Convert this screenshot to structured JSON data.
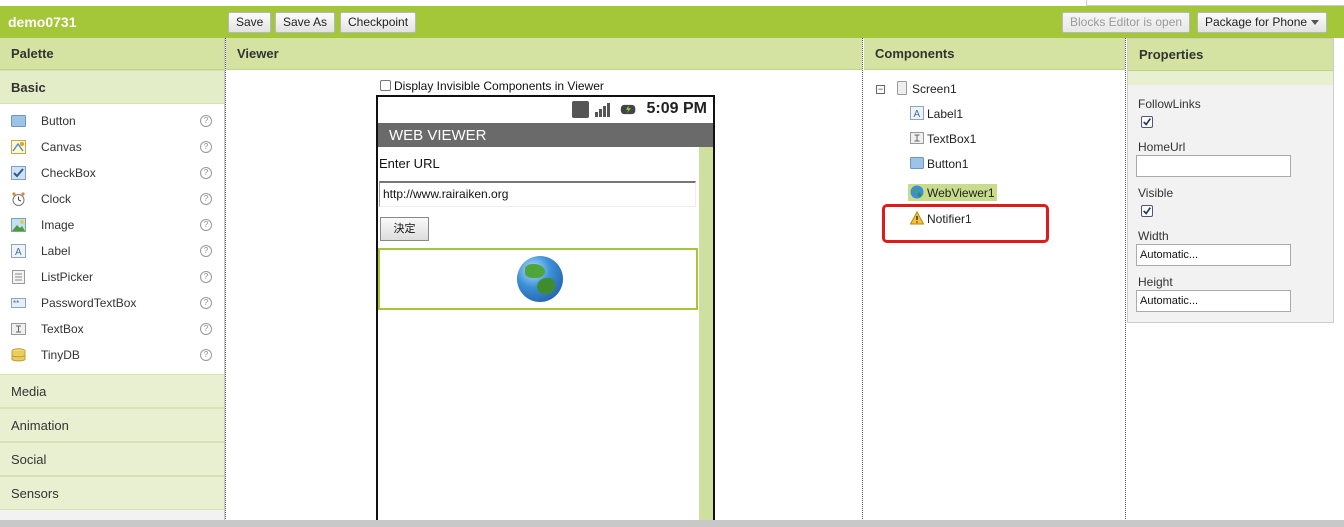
{
  "project": {
    "name": "demo0731"
  },
  "toolbar": {
    "save": "Save",
    "save_as": "Save As",
    "checkpoint": "Checkpoint",
    "blocks_editor": "Blocks Editor is open",
    "package": "Package for Phone"
  },
  "palette": {
    "title": "Palette",
    "basic": "Basic",
    "items": [
      {
        "label": "Button",
        "icon": "button-icon"
      },
      {
        "label": "Canvas",
        "icon": "canvas-icon"
      },
      {
        "label": "CheckBox",
        "icon": "checkbox-icon"
      },
      {
        "label": "Clock",
        "icon": "clock-icon"
      },
      {
        "label": "Image",
        "icon": "image-icon"
      },
      {
        "label": "Label",
        "icon": "label-icon"
      },
      {
        "label": "ListPicker",
        "icon": "listpicker-icon"
      },
      {
        "label": "PasswordTextBox",
        "icon": "passwordtextbox-icon"
      },
      {
        "label": "TextBox",
        "icon": "textbox-icon"
      },
      {
        "label": "TinyDB",
        "icon": "tinydb-icon"
      }
    ],
    "help": "?",
    "sections": [
      "Media",
      "Animation",
      "Social",
      "Sensors"
    ]
  },
  "viewer": {
    "title": "Viewer",
    "display_invisible": "Display Invisible Components in Viewer",
    "status_time": "5:09 PM",
    "screen_title": "WEB VIEWER",
    "enter_url": "Enter URL",
    "url_value": "http://www.rairaiken.org",
    "button_label": "決定"
  },
  "components": {
    "title": "Components",
    "collapse": "⊟",
    "tree": [
      {
        "label": "Screen1",
        "icon": "screen-icon"
      },
      {
        "label": "Label1",
        "icon": "label-icon"
      },
      {
        "label": "TextBox1",
        "icon": "textbox-icon"
      },
      {
        "label": "Button1",
        "icon": "button-icon"
      },
      {
        "label": "WebViewer1",
        "icon": "webviewer-icon",
        "selected": true
      },
      {
        "label": "Notifier1",
        "icon": "notifier-icon"
      }
    ]
  },
  "properties": {
    "title": "Properties",
    "follow_links": "FollowLinks",
    "follow_links_checked": true,
    "home_url": "HomeUrl",
    "home_url_value": "",
    "visible": "Visible",
    "visible_checked": true,
    "width": "Width",
    "width_value": "Automatic...",
    "height": "Height",
    "height_value": "Automatic..."
  },
  "colors": {
    "header_green": "#a4c639",
    "highlight_red": "#e01a1a"
  }
}
